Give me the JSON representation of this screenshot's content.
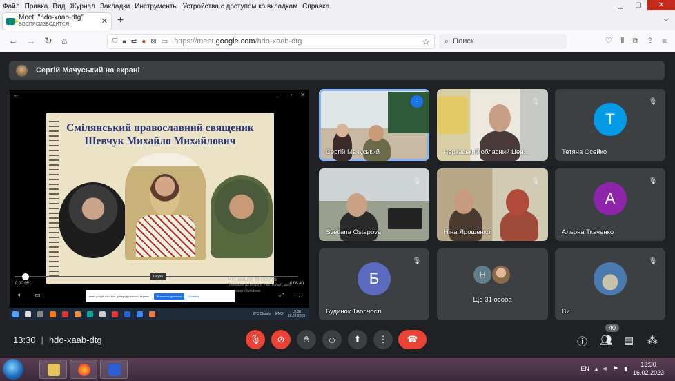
{
  "browser": {
    "menu": [
      "Файл",
      "Правка",
      "Вид",
      "Журнал",
      "Закладки",
      "Инструменты",
      "Устройства с доступом ко вкладкам",
      "Справка"
    ],
    "tab": {
      "title": "Meet: \"hdo-xaab-dtg\"",
      "subtitle": "ВОСПРОИЗВОДИТСЯ"
    },
    "url_prefix": "https://meet.",
    "url_domain": "google.com",
    "url_path": "/hdo-xaab-dtg",
    "search_placeholder": "Поиск"
  },
  "meet": {
    "banner": "Сергій Мачуський на екрані",
    "slide": {
      "title_line1": "Смілянський православний священик",
      "title_line2": "Шевчук Михайло Михайлович"
    },
    "video": {
      "time_current": "0:00:05",
      "time_total": "0:06:40",
      "pause_tooltip": "Пауза",
      "activation_title": "Активація Windows",
      "activation_text": "Перейдіть до розділу \"Настройки\", щоб активувати Windows.",
      "share_text": "meet.google.com має доступ до вашого екрана.",
      "share_stop": "Більше не ділитися",
      "share_hide": "Сховати",
      "inner_weather": "0°C Cloudy",
      "inner_lang": "ENG",
      "inner_time": "13:30",
      "inner_date": "16.02.2023"
    },
    "participants": [
      {
        "name": "Сергій Мачуський"
      },
      {
        "name": "Черкаський обласний Цен..."
      },
      {
        "name": "Тетяна Осейко",
        "initial": "Т",
        "color": "#039be5"
      },
      {
        "name": "Svetlana Ostapova"
      },
      {
        "name": "Ніна Ярошенко"
      },
      {
        "name": "Альона Ткаченко",
        "initial": "А",
        "color": "#8e24aa"
      },
      {
        "name": "Будинок Творчості",
        "initial": "Б",
        "color": "#5c6bc0"
      },
      {
        "name": "Ще 31 особа",
        "initial": "Н"
      },
      {
        "name": "Ви"
      }
    ],
    "time": "13:30",
    "meeting_code": "hdo-xaab-dtg",
    "participant_count": "40"
  },
  "taskbar": {
    "lang": "EN",
    "time": "13:30",
    "date": "16.02.2023"
  }
}
